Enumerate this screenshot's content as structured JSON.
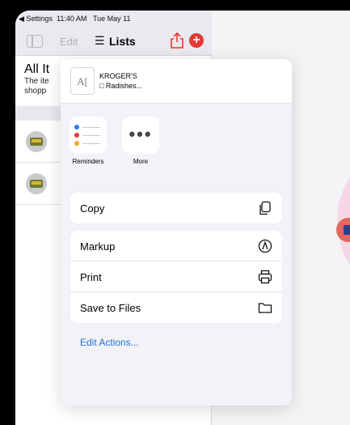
{
  "status": {
    "back_label": "◀ Settings",
    "time": "11:40 AM",
    "date": "Tue May 11"
  },
  "toolbar": {
    "edit_label": "Edit",
    "lists_icon": "☰",
    "lists_label": "Lists",
    "add_glyph": "+"
  },
  "list": {
    "title": "All It",
    "description": "The ite shopp"
  },
  "share": {
    "doc_glyph": "A[",
    "title": "KROGER'S",
    "subtitle": "□ Radishes...",
    "apps": [
      {
        "label": "Reminders",
        "icon": "reminders-icon"
      },
      {
        "label": "More",
        "icon": "more-icon"
      }
    ],
    "copy_label": "Copy",
    "markup_label": "Markup",
    "print_label": "Print",
    "save_label": "Save to Files",
    "edit_actions_label": "Edit Actions..."
  },
  "colors": {
    "accent": "#1a73d9",
    "add_red": "#e53935",
    "share_icon": "#e53935"
  }
}
